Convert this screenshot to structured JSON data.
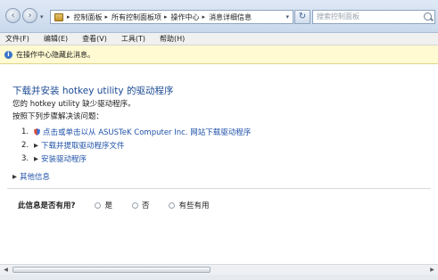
{
  "window": {
    "breadcrumbs": [
      "控制面板",
      "所有控制面板项",
      "操作中心",
      "消息详细信息"
    ],
    "search_placeholder": "搜索控制面板"
  },
  "menu": [
    "文件(F)",
    "编辑(E)",
    "查看(V)",
    "工具(T)",
    "帮助(H)"
  ],
  "infobar": {
    "text": "在操作中心隐藏此消息。"
  },
  "main": {
    "heading": "下载并安装  hotkey utility 的驱动程序",
    "line1": "您的  hotkey utility 缺少驱动程序。",
    "line2": "按照下列步骤解决该问题：",
    "steps": [
      {
        "num": "1.",
        "label": "点击或单击以从  ASUSTeK Computer Inc. 网站下载驱动程序"
      },
      {
        "num": "2.",
        "label": "下载并提取驱动程序文件"
      },
      {
        "num": "3.",
        "label": "安装驱动程序"
      }
    ],
    "more_info": "其他信息"
  },
  "feedback": {
    "question": "此信息是否有用?",
    "options": [
      "是",
      "否",
      "有些有用"
    ]
  }
}
